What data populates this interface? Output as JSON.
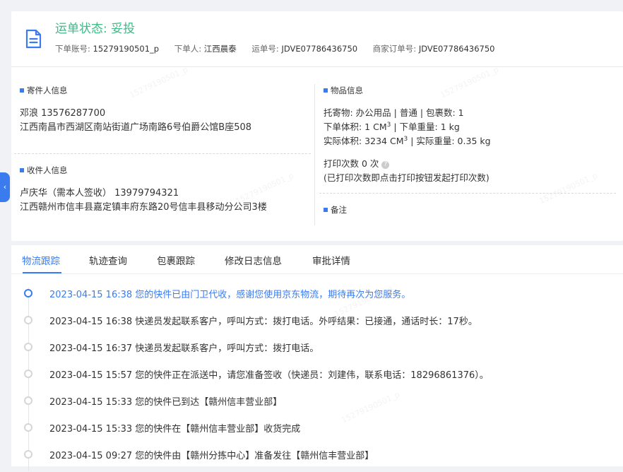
{
  "header": {
    "status_prefix": "运单状态:",
    "status_value": "妥投",
    "meta": [
      {
        "key": "下单账号:",
        "value": "15279190501_p"
      },
      {
        "key": "下单人:",
        "value": "江西晨泰"
      },
      {
        "key": "运单号:",
        "value": "JDVE07786436750"
      },
      {
        "key": "商家订单号:",
        "value": "JDVE07786436750"
      }
    ]
  },
  "sender": {
    "title": "寄件人信息",
    "name_phone": "邓浪   13576287700",
    "address": "江西南昌市西湖区南站街道广场南路6号伯爵公馆B座508"
  },
  "receiver": {
    "title": "收件人信息",
    "name_phone": "卢庆华（需本人签收）  13979794321",
    "address": "江西赣州市信丰县嘉定镇丰府东路20号信丰县移动分公司3楼"
  },
  "goods": {
    "title": "物品信息",
    "line1": "托寄物:  办公用品 | 普通  |  包裹数:  1",
    "line2_a": "下单体积:    1 CM",
    "line2_b": "  |  下单重量:   1 kg",
    "line3_a": "实际体积:    3234 CM",
    "line3_b": "  |  实际重量:    0.35 kg",
    "sup": "3",
    "print_label": "打印次数    0 次",
    "print_note": "(已打印次数即点击打印按钮发起打印次数)"
  },
  "remark": {
    "title": "备注"
  },
  "side_tab": "‹",
  "tabs": [
    "物流跟踪",
    "轨迹查询",
    "包裹跟踪",
    "修改日志信息",
    "审批详情"
  ],
  "timeline": [
    "2023-04-15 16:38 您的快件已由门卫代收，感谢您使用京东物流，期待再次为您服务。",
    "2023-04-15 16:38 快递员发起联系客户，呼叫方式：拨打电话。外呼结果：已接通，通话时长：17秒。",
    "2023-04-15 16:37 快递员发起联系客户，呼叫方式：拨打电话。",
    "2023-04-15 15:57 您的快件正在派送中，请您准备签收（快递员：刘建伟，联系电话：18296861376）。",
    "2023-04-15 15:33 您的快件已到达【赣州信丰营业部】",
    "2023-04-15 15:33 您的快件在【赣州信丰营业部】收货完成",
    "2023-04-15 09:27 您的快件由【赣州分拣中心】准备发往【赣州信丰营业部】"
  ],
  "colors": {
    "accent": "#3a7cf0",
    "status": "#3fba86"
  },
  "watermark": "15279190501_p"
}
